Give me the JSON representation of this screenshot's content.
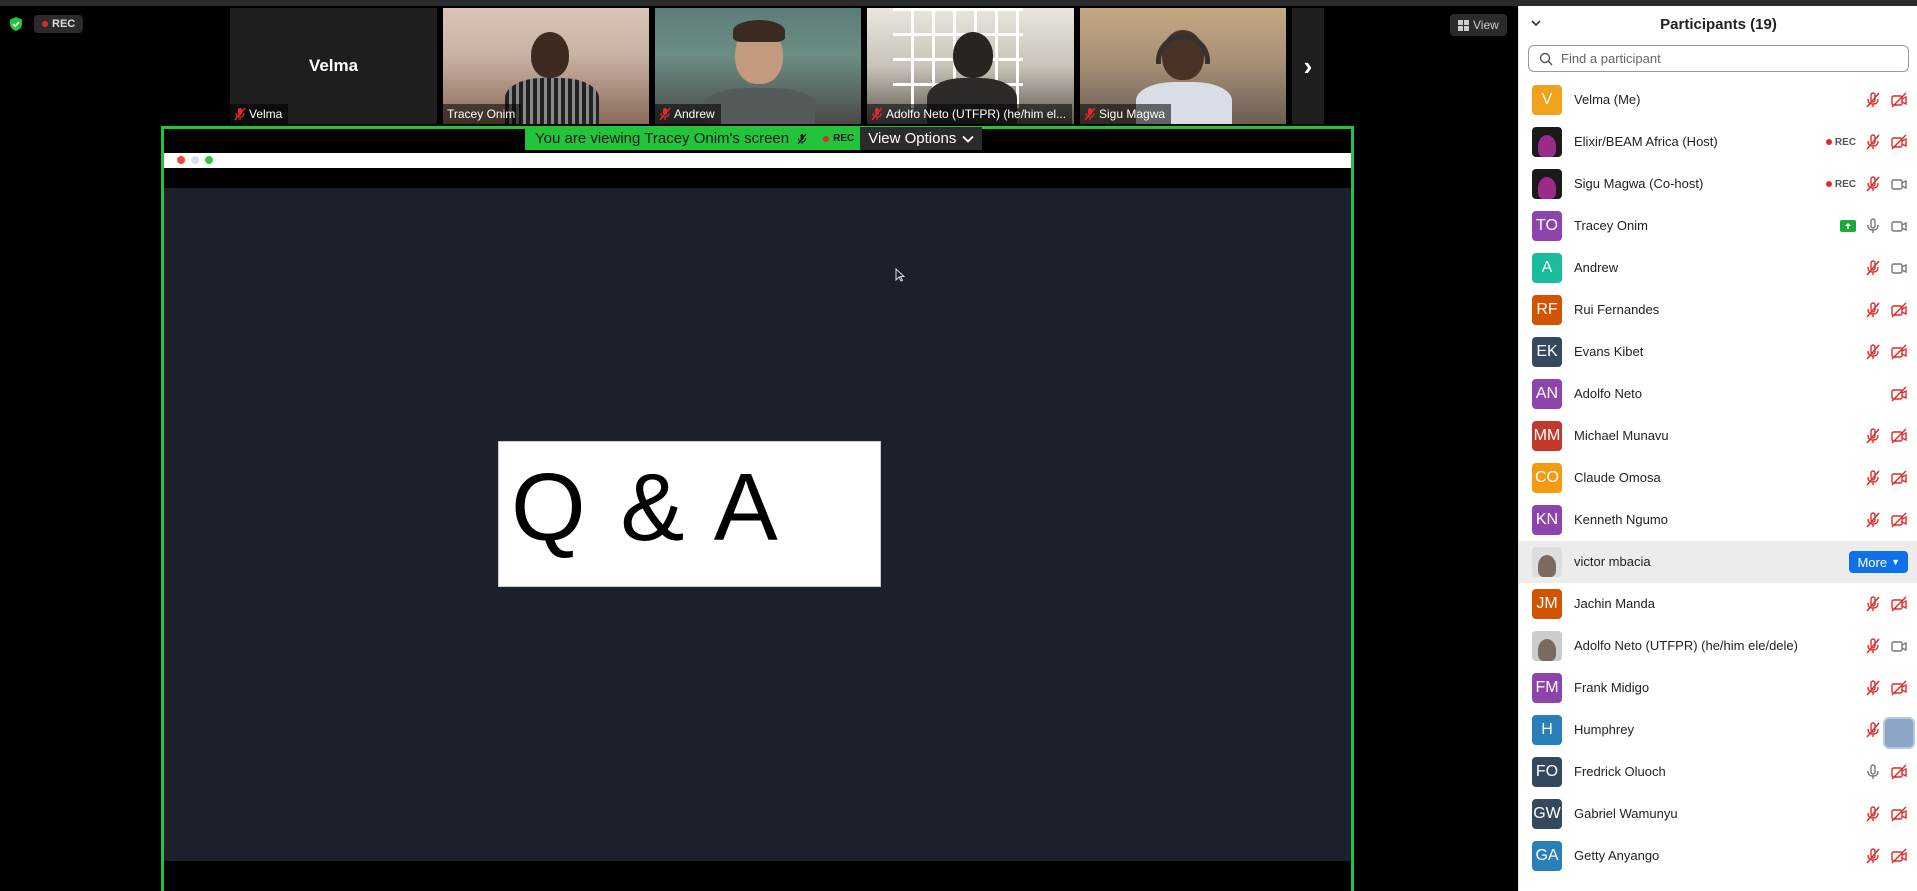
{
  "top": {
    "rec_label": "REC",
    "view_label": "View"
  },
  "thumbnails": [
    {
      "name": "Velma",
      "big_name": "Velma",
      "muted": true
    },
    {
      "name": "Tracey Onim",
      "muted": false
    },
    {
      "name": "Andrew",
      "muted": true
    },
    {
      "name": "Adolfo Neto (UTFPR) (he/him el...",
      "muted": true
    },
    {
      "name": "Sigu Magwa",
      "muted": true
    }
  ],
  "share": {
    "banner_text": "You are viewing Tracey Onim's screen",
    "rec_label": "REC",
    "view_options_label": "View Options",
    "slide_text": "Q & A"
  },
  "participants": {
    "title": "Participants (19)",
    "search_placeholder": "Find a participant",
    "more_label": "More",
    "list": [
      {
        "name": "Velma (Me)",
        "initials": "V",
        "color": "#f0a21a",
        "rec": false,
        "mic": "muted",
        "video": "off"
      },
      {
        "name": "Elixir/BEAM Africa (Host)",
        "initials": "",
        "color": "#1a1a1a",
        "rec": true,
        "mic": "muted",
        "video": "off"
      },
      {
        "name": "Sigu Magwa (Co-host)",
        "initials": "",
        "color": "#1a1a1a",
        "rec": true,
        "mic": "muted",
        "video": "on"
      },
      {
        "name": "Tracey Onim",
        "initials": "TO",
        "color": "#8e44ad",
        "rec": false,
        "share": true,
        "mic": "on",
        "video": "on"
      },
      {
        "name": "Andrew",
        "initials": "A",
        "color": "#1abc9c",
        "rec": false,
        "mic": "muted",
        "video": "on"
      },
      {
        "name": "Rui Fernandes",
        "initials": "RF",
        "color": "#d35400",
        "rec": false,
        "mic": "muted",
        "video": "off"
      },
      {
        "name": "Evans Kibet",
        "initials": "EK",
        "color": "#34495e",
        "rec": false,
        "mic": "muted",
        "video": "off"
      },
      {
        "name": "Adolfo Neto",
        "initials": "AN",
        "color": "#8e44ad",
        "rec": false,
        "mic": "none",
        "video": "off"
      },
      {
        "name": "Michael Munavu",
        "initials": "MM",
        "color": "#c0392b",
        "rec": false,
        "mic": "muted",
        "video": "off"
      },
      {
        "name": "Claude Omosa",
        "initials": "CO",
        "color": "#f39c12",
        "rec": false,
        "mic": "muted",
        "video": "off"
      },
      {
        "name": "Kenneth Ngumo",
        "initials": "KN",
        "color": "#8e44ad",
        "rec": false,
        "mic": "muted",
        "video": "off"
      },
      {
        "name": "victor mbacia",
        "initials": "",
        "color": "#dddddd",
        "rec": false,
        "hover": true,
        "mic": "none",
        "video": "none"
      },
      {
        "name": "Jachin Manda",
        "initials": "JM",
        "color": "#d35400",
        "rec": false,
        "mic": "muted",
        "video": "off"
      },
      {
        "name": "Adolfo Neto (UTFPR) (he/him ele/dele)",
        "initials": "",
        "color": "#cccccc",
        "rec": false,
        "mic": "muted",
        "video": "on"
      },
      {
        "name": "Frank Midigo",
        "initials": "FM",
        "color": "#8e44ad",
        "rec": false,
        "mic": "muted",
        "video": "off"
      },
      {
        "name": "Humphrey",
        "initials": "H",
        "color": "#2980b9",
        "rec": false,
        "mic": "muted",
        "video": "off"
      },
      {
        "name": "Fredrick Oluoch",
        "initials": "FO",
        "color": "#34495e",
        "rec": false,
        "mic": "on",
        "video": "off"
      },
      {
        "name": "Gabriel Wamunyu",
        "initials": "GW",
        "color": "#34495e",
        "rec": false,
        "mic": "muted",
        "video": "off"
      },
      {
        "name": "Getty Anyango",
        "initials": "GA",
        "color": "#2980b9",
        "rec": false,
        "mic": "muted",
        "video": "off"
      }
    ]
  }
}
